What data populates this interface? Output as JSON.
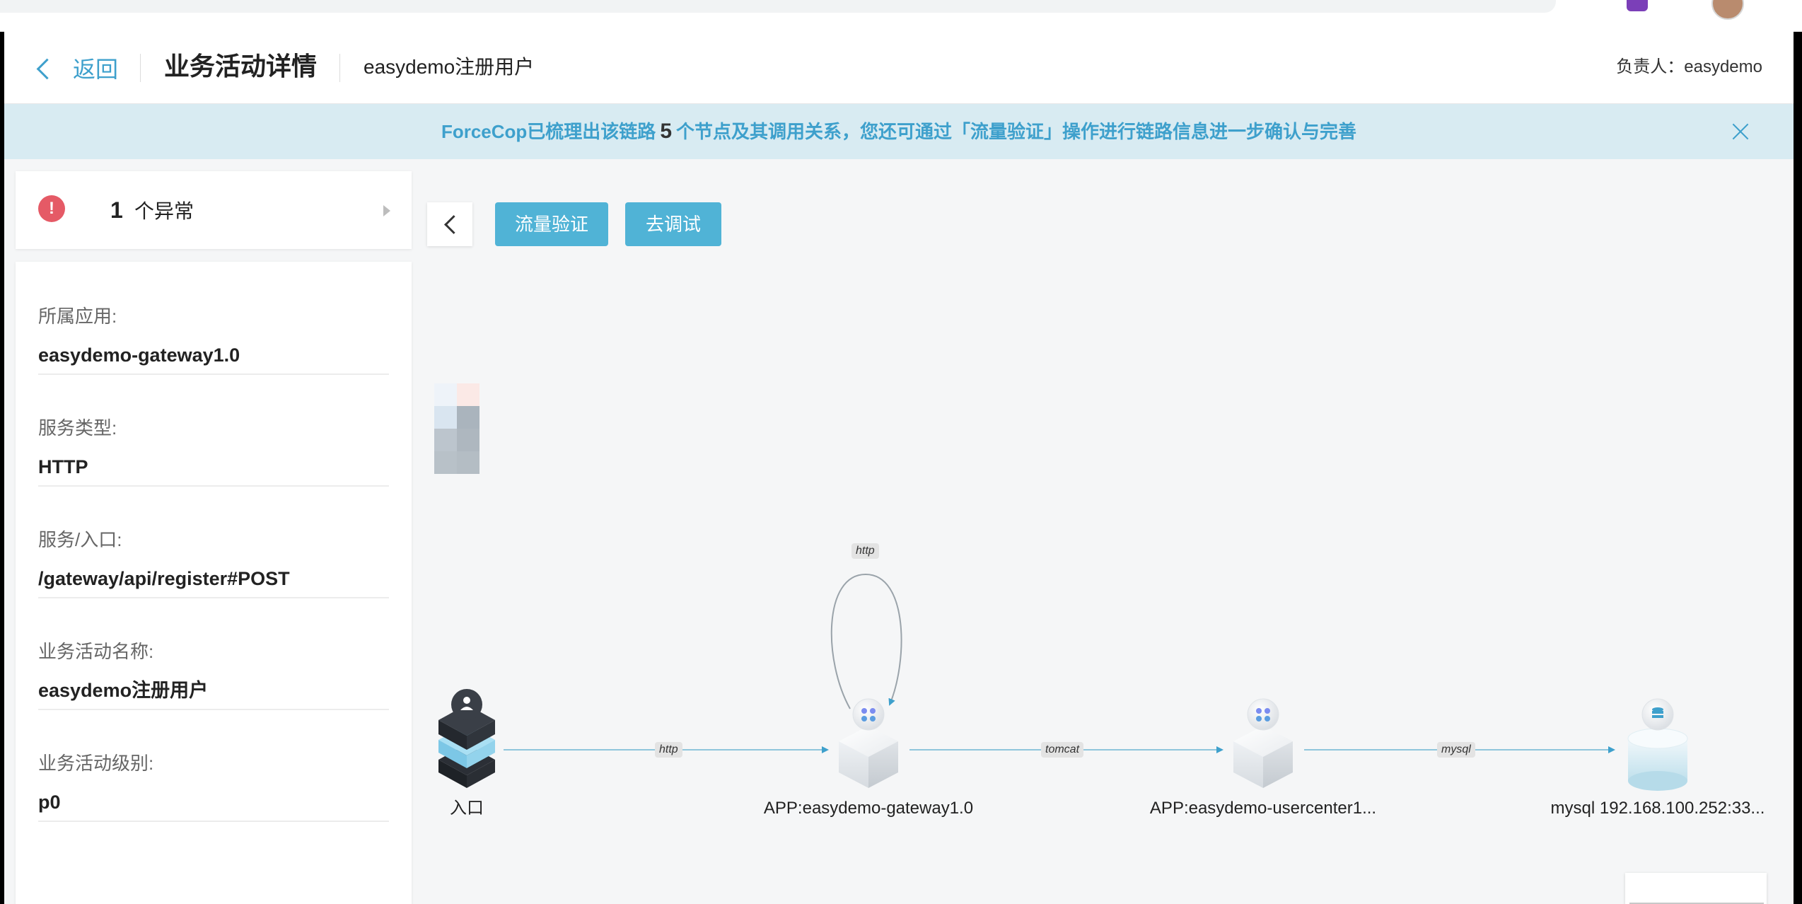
{
  "header": {
    "back_label": "返回",
    "page_title": "业务活动详情",
    "activity_name": "easydemo注册用户",
    "owner": "负责人：easydemo"
  },
  "notice": {
    "prefix": "ForceCop已梳理出该链路",
    "count": "5",
    "suffix": "个节点及其调用关系，您还可通过「流量验证」操作进行链路信息进一步确认与完善"
  },
  "errors": {
    "icon_text": "!",
    "count": "1",
    "label": "个异常"
  },
  "info": {
    "fields": [
      {
        "label": "所属应用:",
        "value": "easydemo-gateway1.0"
      },
      {
        "label": "服务类型:",
        "value": "HTTP"
      },
      {
        "label": "服务/入口:",
        "value": "/gateway/api/register#POST"
      },
      {
        "label": "业务活动名称:",
        "value": "easydemo注册用户"
      },
      {
        "label": "业务活动级别:",
        "value": "p0"
      }
    ]
  },
  "toolbar": {
    "traffic_verify": "流量验证",
    "debug": "去调试"
  },
  "graph": {
    "nodes": [
      {
        "label": "入口",
        "icon": "user-entry-icon"
      },
      {
        "label": "APP:easydemo-gateway1.0",
        "icon": "app-cube-icon"
      },
      {
        "label": "APP:easydemo-usercenter1...",
        "icon": "app-cube-icon"
      },
      {
        "label": "mysql 192.168.100.252:33...",
        "icon": "database-icon"
      }
    ],
    "edges": [
      {
        "label": "http",
        "from": "入口",
        "to": "APP:easydemo-gateway1.0"
      },
      {
        "label": "http",
        "from": "APP:easydemo-gateway1.0",
        "to": "APP:easydemo-gateway1.0"
      },
      {
        "label": "tomcat",
        "from": "APP:easydemo-gateway1.0",
        "to": "APP:easydemo-usercenter1..."
      },
      {
        "label": "mysql",
        "from": "APP:easydemo-usercenter1...",
        "to": "mysql 192.168.100.252:33..."
      }
    ]
  },
  "colors": {
    "accent": "#3ea0cc",
    "button": "#50b3d6",
    "notice_bg": "#d8ebf2",
    "error": "#e55a66"
  }
}
